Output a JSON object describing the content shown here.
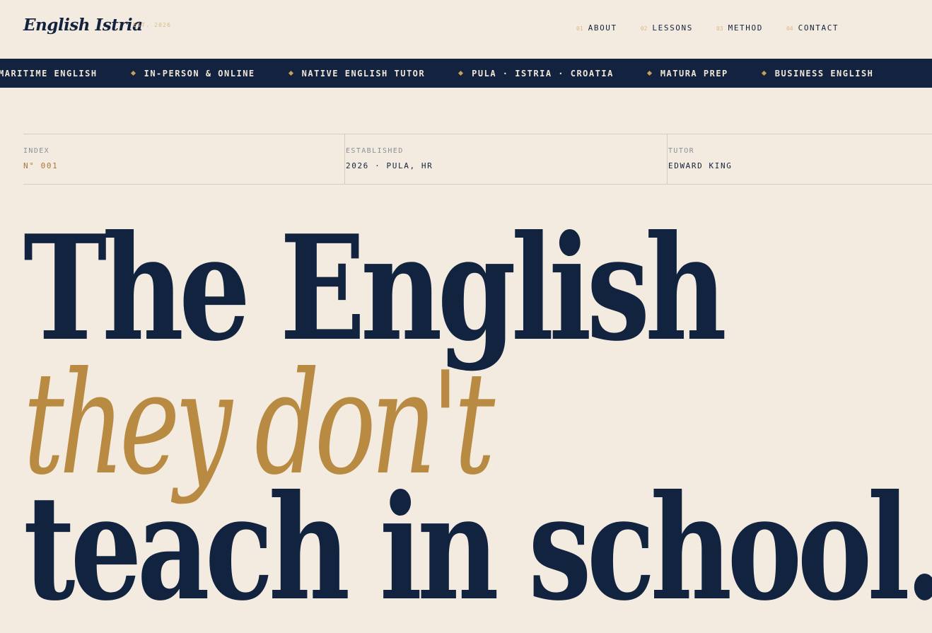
{
  "header": {
    "logo": "English Istria",
    "est": "EST. 2026",
    "nav": [
      {
        "num": "01",
        "label": "ABOUT"
      },
      {
        "num": "02",
        "label": "LESSONS"
      },
      {
        "num": "03",
        "label": "METHOD"
      },
      {
        "num": "04",
        "label": "CONTACT"
      }
    ]
  },
  "marquee": {
    "lead": "MARITIME ENGLISH",
    "items": [
      "IN-PERSON & ONLINE",
      "NATIVE ENGLISH TUTOR",
      "PULA · ISTRIA · CROATIA",
      "MATURA PREP",
      "BUSINESS ENGLISH"
    ]
  },
  "meta": {
    "index": {
      "label": "INDEX",
      "value": "N° 001"
    },
    "established": {
      "label": "ESTABLISHED",
      "value": "2026 · PULA, HR"
    },
    "tutor": {
      "label": "TUTOR",
      "value": "EDWARD KING"
    }
  },
  "hero": {
    "line1": "The English",
    "line2": "they don't",
    "line3": "teach in school."
  },
  "colors": {
    "background": "#f3ebe0",
    "navy": "#13233f",
    "gold": "#b98a41",
    "accent_light": "#d9b98a"
  }
}
